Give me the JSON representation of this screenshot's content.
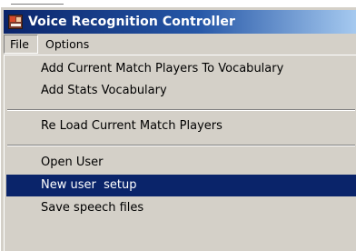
{
  "window": {
    "title": "Voice Recognition Controller",
    "icon": "app-icon"
  },
  "menubar": {
    "items": [
      {
        "label": "File",
        "active": true
      },
      {
        "label": "Options",
        "active": false
      }
    ]
  },
  "file_menu": {
    "items": [
      {
        "label": "Add Current Match Players To Vocabulary",
        "selected": false
      },
      {
        "label": "Add Stats Vocabulary",
        "selected": false
      },
      {
        "label": "Re Load Current Match Players",
        "selected": false
      },
      {
        "label": "Open User",
        "selected": false
      },
      {
        "label": "New user  setup",
        "selected": true
      },
      {
        "label": "Save speech files",
        "selected": false
      }
    ]
  },
  "colors": {
    "titlebar_start": "#0a246a",
    "titlebar_end": "#a6caf0",
    "menu_background": "#d4d0c8",
    "selection": "#0a246a",
    "selection_text": "#ffffff"
  }
}
